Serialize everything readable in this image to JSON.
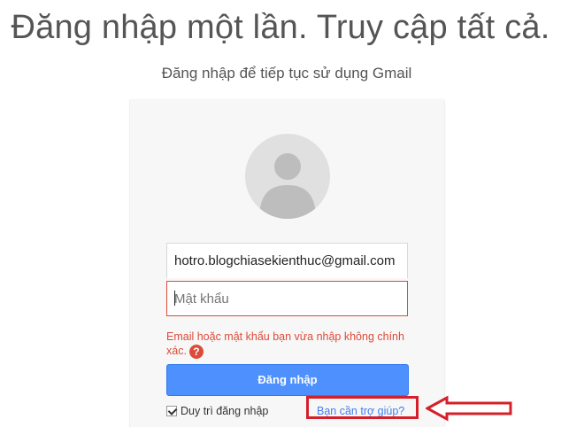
{
  "header": {
    "headline": "Đăng nhập một lần. Truy cập tất cả.",
    "subtitle": "Đăng nhập để tiếp tục sử dụng Gmail"
  },
  "login_form": {
    "email_value": "hotro.blogchiasekienthuc@gmail.com",
    "password_placeholder": "Mật khẩu",
    "error_message": "Email hoặc mật khẩu bạn vừa nhập không chính xác.",
    "help_icon_glyph": "?",
    "signin_label": "Đăng nhập",
    "stay_signed_in_label": "Duy trì đăng nhập",
    "stay_signed_in_checked": true,
    "help_link_label": "Bạn cần trợ giúp?"
  },
  "annotations": {
    "highlight_color": "#d4202a",
    "arrow_icon": "left-arrow-outline-icon"
  },
  "colors": {
    "error": "#dd4b39",
    "button": "#4d90fe",
    "link": "#427fed"
  }
}
